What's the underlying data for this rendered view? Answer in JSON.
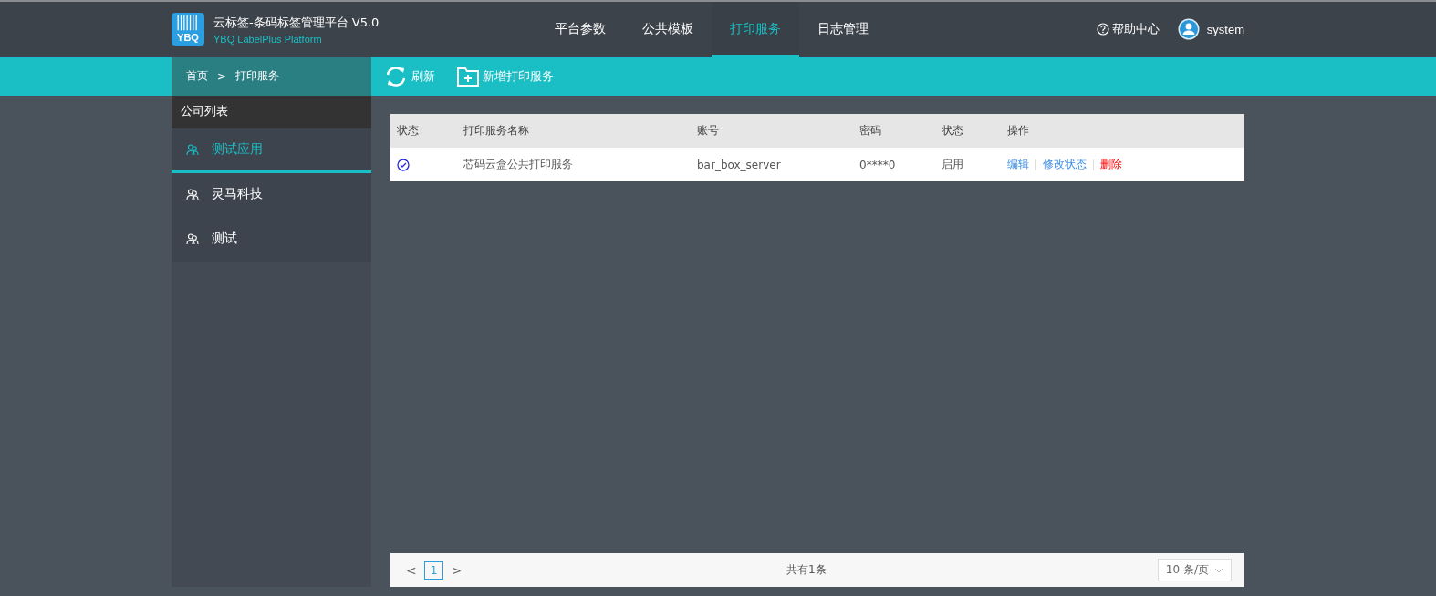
{
  "header": {
    "logo_text": "YBQ",
    "title": "云标签-条码标签管理平台 V5.0",
    "subtitle": "YBQ LabelPlus Platform",
    "nav": [
      {
        "label": "平台参数",
        "selected": false
      },
      {
        "label": "公共模板",
        "selected": false
      },
      {
        "label": "打印服务",
        "selected": true
      },
      {
        "label": "日志管理",
        "selected": false
      }
    ],
    "help": "帮助中心",
    "user": "system"
  },
  "breadcrumb": [
    "首页",
    ">",
    "打印服务"
  ],
  "toolbar": [
    {
      "kind": "refresh",
      "label": "刷新"
    },
    {
      "kind": "add",
      "label": "新增打印服务"
    }
  ],
  "sidebar": {
    "title": "公司列表",
    "items": [
      {
        "label": "测试应用",
        "selected": true
      },
      {
        "label": "灵马科技",
        "selected": false
      },
      {
        "label": "测试",
        "selected": false
      }
    ]
  },
  "table": {
    "columns": [
      "状态",
      "打印服务名称",
      "账号",
      "密码",
      "状态",
      "操作"
    ],
    "rows": [
      {
        "checked": true,
        "name": "芯码云盒公共打印服务",
        "account": "bar_box_server",
        "password": "0****0",
        "status": "启用",
        "actions": [
          {
            "label": "编辑",
            "kind": "normal"
          },
          {
            "label": "修改状态",
            "kind": "normal"
          },
          {
            "label": "删除",
            "kind": "danger"
          }
        ]
      }
    ]
  },
  "pagination": {
    "prev": "<",
    "pages": [
      {
        "label": "1",
        "selected": true
      }
    ],
    "next": ">",
    "total": "共有1条",
    "page_size": "10 条/页"
  }
}
